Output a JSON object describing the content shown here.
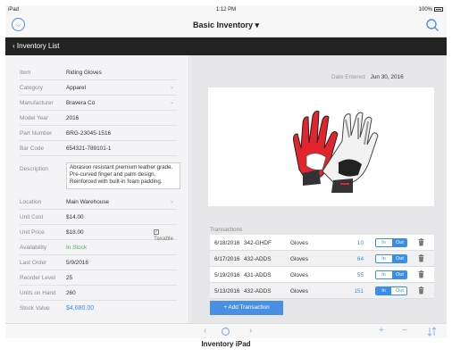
{
  "status_bar": {
    "device": "iPad",
    "time": "1:12 PM",
    "battery": "100%"
  },
  "title_bar": {
    "title": "Basic Inventory ▾"
  },
  "nav_bar": {
    "back_label": "Inventory List"
  },
  "fields": [
    {
      "label": "Item",
      "value": "Riding Gloves",
      "dropdown": false
    },
    {
      "label": "Category",
      "value": "Apparel",
      "dropdown": true
    },
    {
      "label": "Manufacturer",
      "value": "Bravera Co",
      "dropdown": true
    },
    {
      "label": "Model Year",
      "value": "2016",
      "dropdown": false
    },
    {
      "label": "Part Number",
      "value": "BRG-23045-1516",
      "dropdown": false
    },
    {
      "label": "Bar Code",
      "value": "654321-789101-1",
      "dropdown": false
    }
  ],
  "description": {
    "label": "Description",
    "value": "Abrasion resistant premium leather grade. Pre-curved finger and palm design. Reinforced with built-in foam padding."
  },
  "fields2": [
    {
      "label": "Location",
      "value": "Main Warehouse",
      "dropdown": true
    },
    {
      "label": "Unit Cost",
      "value": "$14.00"
    },
    {
      "label": "Unit Price",
      "value": "$18.00",
      "taxable_label": "Taxable",
      "taxable_checked": true
    },
    {
      "label": "Availability",
      "value": "In Stock"
    },
    {
      "label": "Last Order",
      "value": "5/9/2016"
    },
    {
      "label": "Reorder Level",
      "value": "25"
    },
    {
      "label": "Units on Hand",
      "value": "260"
    },
    {
      "label": "Stock Value",
      "value": "$4,680.00"
    }
  ],
  "date_entered": {
    "label": "Date Entered",
    "value": "Jun 30, 2016"
  },
  "transactions": {
    "title": "Transactions",
    "in_label": "In",
    "out_label": "Out",
    "rows": [
      {
        "date": "6/18/2016",
        "part": "342-GHDF",
        "name": "Gloves",
        "qty": "10",
        "selected": "out"
      },
      {
        "date": "6/17/2016",
        "part": "432-ADDS",
        "name": "Gloves",
        "qty": "64",
        "selected": "out"
      },
      {
        "date": "5/19/2016",
        "part": "431-ADDS",
        "name": "Gloves",
        "qty": "55",
        "selected": "out"
      },
      {
        "date": "5/13/2016",
        "part": "432-ADDS",
        "name": "Gloves",
        "qty": "151",
        "selected": "in"
      }
    ],
    "add_label": "+ Add Transaction"
  },
  "toolbar": {
    "prev": "‹",
    "next": "›",
    "add": "+",
    "remove": "−"
  },
  "caption": "Inventory iPad",
  "colors": {
    "accent": "#4a90e2",
    "nav": "#222222",
    "in_stock": "#5aa75a",
    "glove_red": "#e2242c"
  },
  "icons": [
    "menu-circle-icon",
    "search-icon",
    "chevron-left-icon",
    "chevron-down-icon",
    "checkbox-icon",
    "trash-icon",
    "refresh-icon",
    "plus-icon",
    "minus-icon",
    "sort-icon"
  ]
}
